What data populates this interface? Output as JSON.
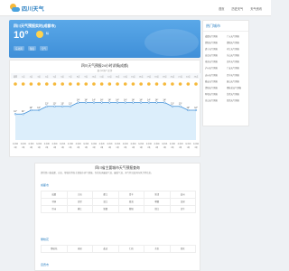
{
  "header": {
    "logo_text": "四川天气",
    "nav": [
      "首页",
      "历史天气",
      "天气资讯"
    ]
  },
  "banner": {
    "title": "四川天气预报实时(成都市)",
    "temperature": "10°",
    "condition": "晴",
    "wind": "东北风",
    "humidity": "湿度",
    "aqi": "空气"
  },
  "sidebar": {
    "title": "热门城市",
    "cities": [
      "成都天气预报",
      "广元天气预报",
      "德阳天气预报",
      "绵阳天气预报",
      "遂宁天气预报",
      "内江天气预报",
      "自贡天气预报",
      "乐山天气预报",
      "南充天气预报",
      "宜宾天气预报",
      "泸州天气预报",
      "广安天气预报",
      "达州天气预报",
      "巴中天气预报",
      "雅安天气预报",
      "眉山天气预报",
      "资阳天气预报",
      "攀枝花天气预报",
      "阿坝天气预报",
      "甘孜天气预报",
      "凉山天气预报",
      "西昌天气预报"
    ]
  },
  "forecast24": {
    "title": "四川天气预报24小时详情(成都)",
    "subtitle": "逐小时天气走势",
    "hours": [
      "周四",
      "1点",
      "2点",
      "3点",
      "4点",
      "5点",
      "6点",
      "7点",
      "8点",
      "9点",
      "10点",
      "11点",
      "12点",
      "13点",
      "14点",
      "15点",
      "16点",
      "17点",
      "18点",
      "19点",
      "20点",
      "21点",
      "22点",
      "23点"
    ],
    "temps": [
      11,
      11,
      12,
      12,
      13,
      13,
      13,
      13,
      14,
      14,
      14,
      14,
      14,
      14,
      14,
      14,
      14,
      14,
      14,
      14,
      13,
      13,
      12,
      12
    ],
    "wind": "东北风",
    "wind_level": "1级"
  },
  "province": {
    "title": "四川省主要城市天气预报查询",
    "description": "提供四川省成都、自贡、攀枝花等各主要城市天气预报，包括每天最高气温、最低气温、天气状况及风向风力等信息。",
    "sections": [
      {
        "label": "成都市",
        "items": [
          "成都",
          "大邑",
          "都江",
          "青羊",
          "新津",
          "彭州",
          "邛崃",
          "金堂",
          "温江",
          "双流",
          "郫都",
          "龙泉",
          "崇州",
          "蒲江",
          "新都",
          "简阳",
          "锦江",
          "金牛"
        ]
      },
      {
        "label": "攀枝花",
        "items": [
          "攀枝花",
          "米易",
          "盐边",
          "仁和",
          "东区",
          "西区"
        ]
      },
      {
        "label": "自贡市",
        "items": []
      }
    ]
  }
}
